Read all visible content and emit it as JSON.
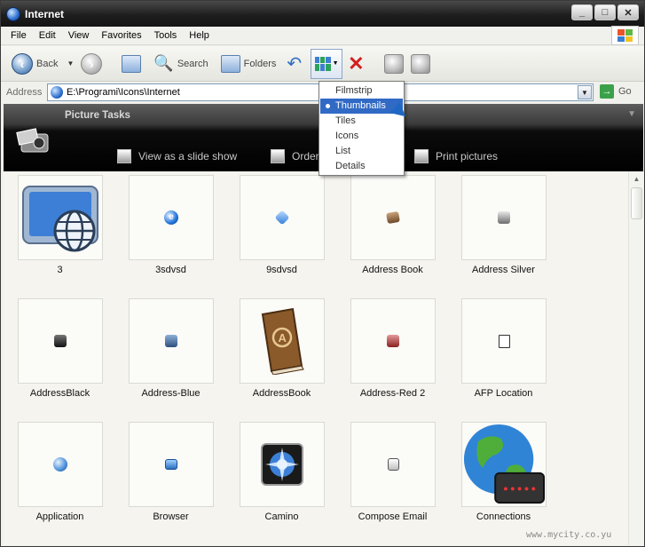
{
  "window": {
    "title": "Internet",
    "buttons": [
      "_",
      "□",
      "✕"
    ]
  },
  "menubar": {
    "items": [
      "File",
      "Edit",
      "View",
      "Favorites",
      "Tools",
      "Help"
    ]
  },
  "toolbar": {
    "back_label": "Back",
    "search_label": "Search",
    "folders_label": "Folders"
  },
  "addressbar": {
    "label": "Address",
    "value": "E:\\Programi\\Icons\\Internet",
    "go_label": "Go"
  },
  "views_menu": {
    "items": [
      "Filmstrip",
      "Thumbnails",
      "Tiles",
      "Icons",
      "List",
      "Details"
    ],
    "selected": "Thumbnails"
  },
  "task_pane": {
    "heading": "Picture Tasks",
    "tasks": [
      "View as a slide show",
      "Order",
      "Print pictures"
    ]
  },
  "thumbnails": [
    {
      "label": "3",
      "icon": "monitor-globe-icon"
    },
    {
      "label": "3sdvsd",
      "icon": "blue-e-icon"
    },
    {
      "label": "9sdvsd",
      "icon": "blue-gem-icon"
    },
    {
      "label": "Address Book",
      "icon": "address-book-icon"
    },
    {
      "label": "Address Silver",
      "icon": "silver-book-icon"
    },
    {
      "label": "AddressBlack",
      "icon": "black-book-icon"
    },
    {
      "label": "Address-Blue",
      "icon": "blue-book-icon"
    },
    {
      "label": "AddressBook",
      "icon": "brown-book-icon"
    },
    {
      "label": "Address-Red 2",
      "icon": "red-book-icon"
    },
    {
      "label": "AFP Location",
      "icon": "afp-folder-icon"
    },
    {
      "label": "Application",
      "icon": "application-globe-icon"
    },
    {
      "label": "Browser",
      "icon": "browser-icon"
    },
    {
      "label": "Camino",
      "icon": "camino-icon"
    },
    {
      "label": "Compose Email",
      "icon": "compose-email-icon"
    },
    {
      "label": "Connections",
      "icon": "globe-router-icon"
    }
  ],
  "watermark": "www.mycity.co.yu",
  "colors": {
    "selection": "#316ac5",
    "title_bar": "#1e1e1e",
    "task_band": "#000000"
  }
}
